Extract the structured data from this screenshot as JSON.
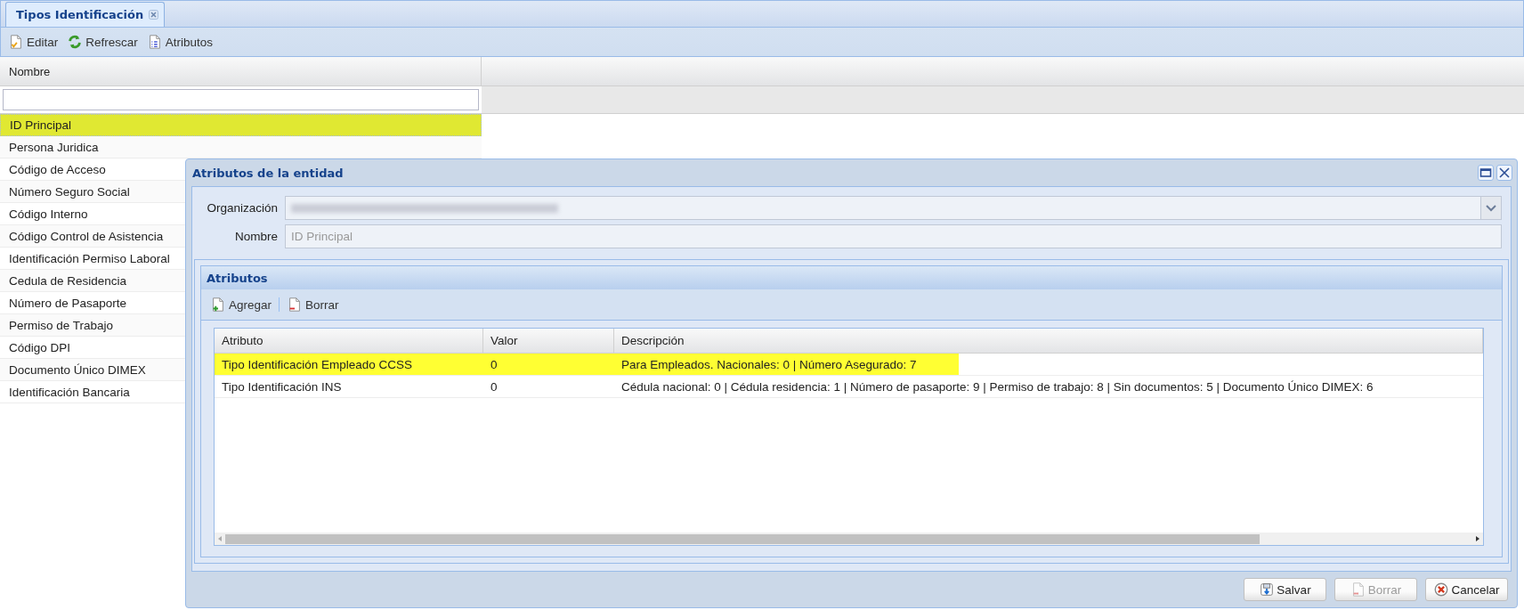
{
  "tab": {
    "title": "Tipos Identificación",
    "selected": true
  },
  "toolbar": [
    {
      "label": "Editar",
      "kind": "edit"
    },
    {
      "label": "Refrescar",
      "kind": "refresh"
    },
    {
      "label": "Atributos",
      "kind": "list"
    }
  ],
  "list": {
    "column": "Nombre",
    "rows": [
      {
        "name": "ID Principal",
        "selected": true
      },
      {
        "name": "Persona Juridica",
        "selected": false
      },
      {
        "name": "Código de Acceso",
        "selected": false
      },
      {
        "name": "Número Seguro Social",
        "selected": false
      },
      {
        "name": "Código Interno",
        "selected": false
      },
      {
        "name": "Código Control de Asistencia",
        "selected": false
      },
      {
        "name": "Identificación Permiso Laboral",
        "selected": false
      },
      {
        "name": "Cedula de Residencia",
        "selected": false
      },
      {
        "name": "Número de Pasaporte",
        "selected": false
      },
      {
        "name": "Permiso de Trabajo",
        "selected": false
      },
      {
        "name": "Código DPI",
        "selected": false
      },
      {
        "name": "Documento Único DIMEX",
        "selected": false
      },
      {
        "name": "Identificación Bancaria",
        "selected": false
      }
    ]
  },
  "dialog": {
    "title": "Atributos de la entidad",
    "fields": [
      {
        "label": "Organización",
        "kind": "combo"
      },
      {
        "label": "Nombre",
        "kind": "text",
        "value": "ID Principal"
      }
    ],
    "panel": {
      "title": "Atributos",
      "toolbar": [
        {
          "label": "Agregar",
          "kind": "add"
        },
        {
          "label": "Borrar",
          "kind": "delete"
        }
      ],
      "grid": {
        "columns": [
          "Atributo",
          "Valor",
          "Descripción"
        ],
        "rows": [
          {
            "cells": [
              "Tipo Identificación Empleado CCSS",
              "0",
              "Para Empleados. Nacionales: 0 | Número Asegurado: 7"
            ],
            "selected": true
          },
          {
            "cells": [
              "Tipo Identificación INS",
              "0",
              "Cédula nacional: 0 | Cédula residencia: 1 | Número de pasaporte: 9 | Permiso de trabajo: 8 | Sin documentos: 5 | Documento Único DIMEX: 6"
            ],
            "selected": false
          }
        ]
      }
    },
    "buttons": [
      {
        "label": "Salvar",
        "kind": "save",
        "disabled": false
      },
      {
        "label": "Borrar",
        "kind": "delete",
        "disabled": true
      },
      {
        "label": "Cancelar",
        "kind": "cancel",
        "disabled": false
      }
    ]
  }
}
